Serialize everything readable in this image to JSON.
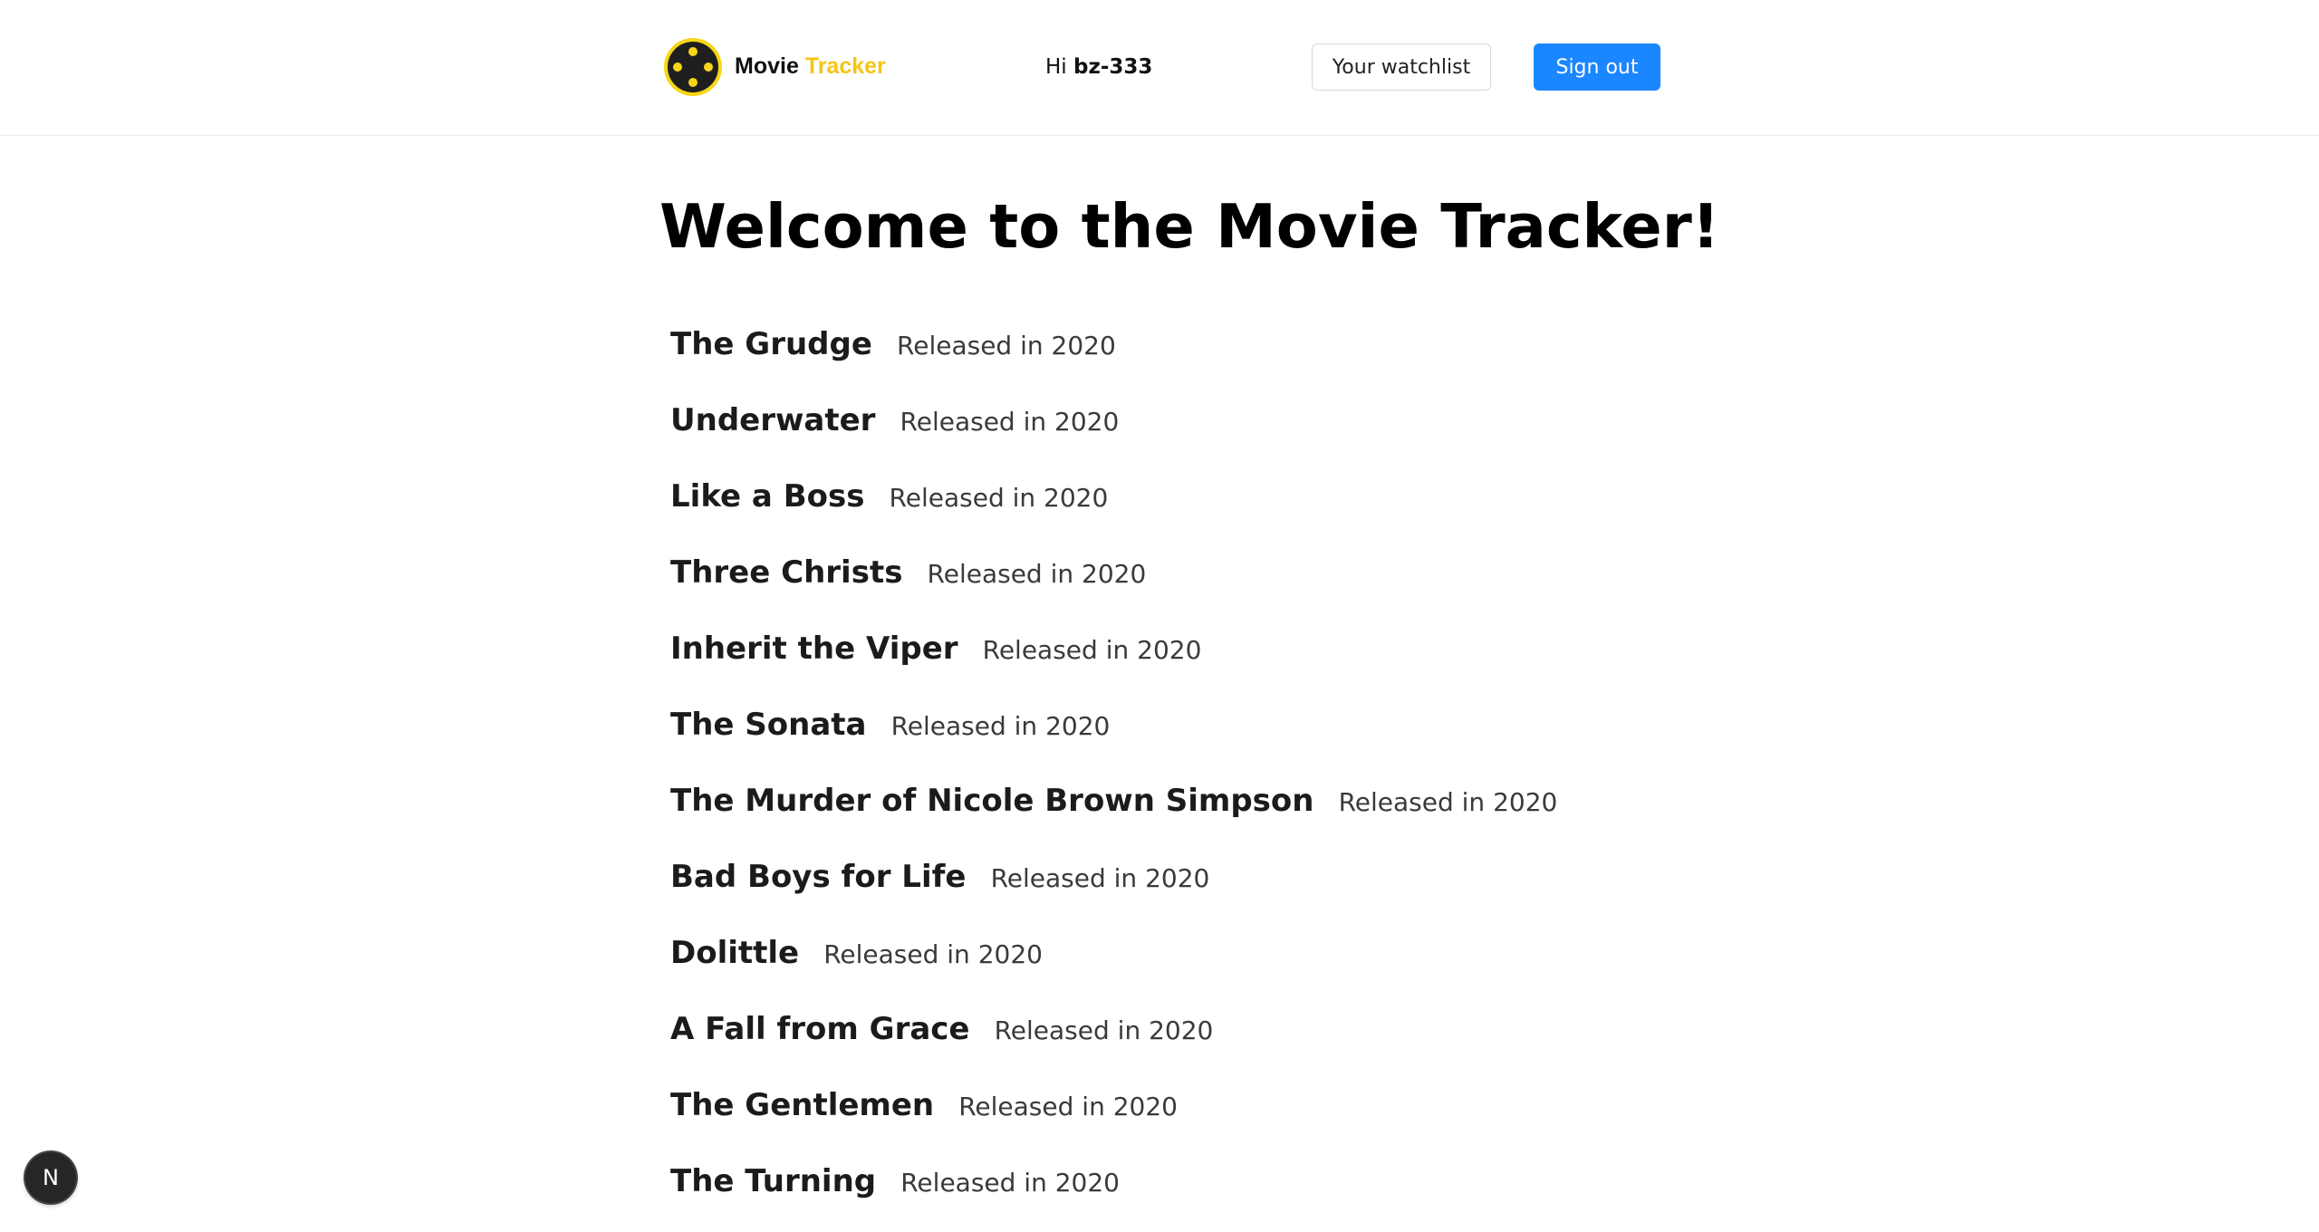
{
  "header": {
    "brand_part1": "Movie",
    "brand_part2": "Tracker",
    "greeting_prefix": "Hi",
    "username": "bz-333",
    "watchlist_label": "Your watchlist",
    "signout_label": "Sign out",
    "logo_icon": "film-reel-icon",
    "colors": {
      "brand_accent": "#f5c518",
      "primary_button": "#1a86ff"
    }
  },
  "main": {
    "title": "Welcome to the Movie Tracker!",
    "movies": [
      {
        "title": "The Grudge",
        "release": "Released in 2020"
      },
      {
        "title": "Underwater",
        "release": "Released in 2020"
      },
      {
        "title": "Like a Boss",
        "release": "Released in 2020"
      },
      {
        "title": "Three Christs",
        "release": "Released in 2020"
      },
      {
        "title": "Inherit the Viper",
        "release": "Released in 2020"
      },
      {
        "title": "The Sonata",
        "release": "Released in 2020"
      },
      {
        "title": "The Murder of Nicole Brown Simpson",
        "release": "Released in 2020"
      },
      {
        "title": "Bad Boys for Life",
        "release": "Released in 2020"
      },
      {
        "title": "Dolittle",
        "release": "Released in 2020"
      },
      {
        "title": "A Fall from Grace",
        "release": "Released in 2020"
      },
      {
        "title": "The Gentlemen",
        "release": "Released in 2020"
      },
      {
        "title": "The Turning",
        "release": "Released in 2020"
      }
    ]
  },
  "devtools": {
    "badge_label": "N",
    "badge_icon": "nextjs-logo-icon"
  }
}
